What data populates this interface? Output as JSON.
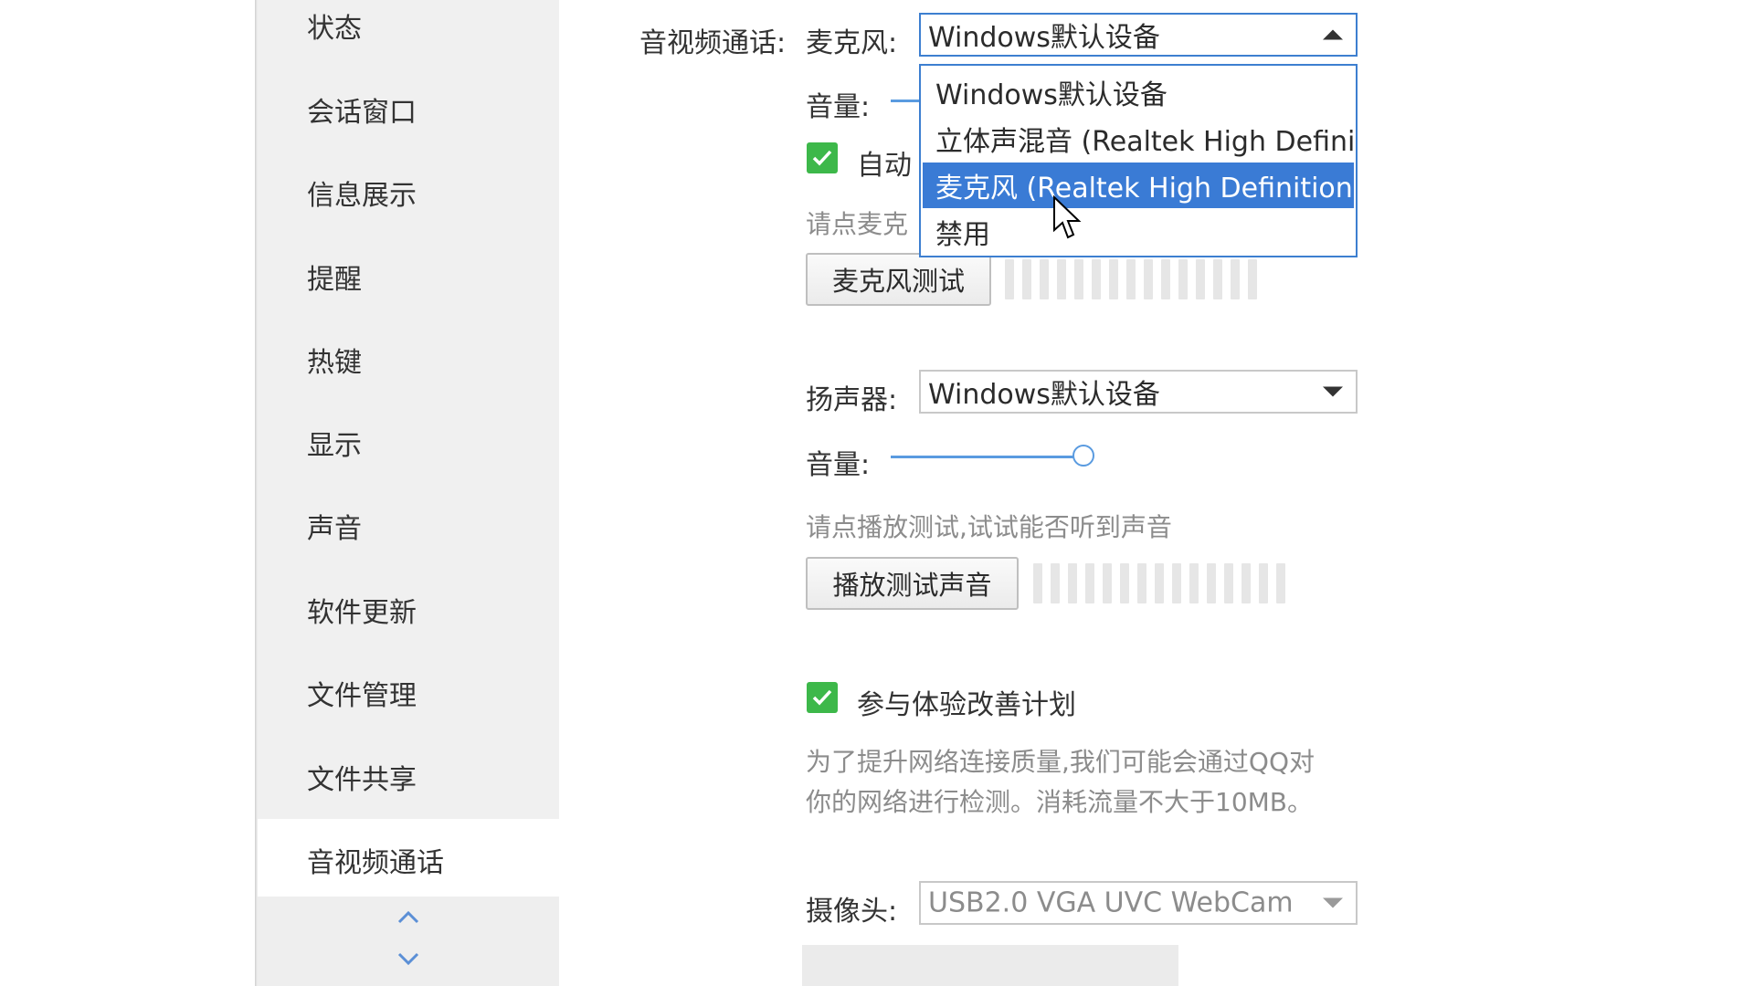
{
  "sidebar": {
    "items": [
      {
        "label": "状态"
      },
      {
        "label": "会话窗口"
      },
      {
        "label": "信息展示"
      },
      {
        "label": "提醒"
      },
      {
        "label": "热键"
      },
      {
        "label": "显示"
      },
      {
        "label": "声音"
      },
      {
        "label": "软件更新"
      },
      {
        "label": "文件管理"
      },
      {
        "label": "文件共享"
      },
      {
        "label": "音视频通话"
      }
    ],
    "active_index": 10,
    "scroll_up_icon": "chevron-up-icon",
    "scroll_down_icon": "chevron-down-icon"
  },
  "section": {
    "title": "音视频通话:"
  },
  "microphone": {
    "label": "麦克风:",
    "selected": "Windows默认设备",
    "volume_label": "音量:",
    "auto_adjust_label_partial": "自动",
    "hint_partial": "请点麦克",
    "test_button": "麦克风测试",
    "dropdown_open": true,
    "options": [
      "Windows默认设备",
      "立体声混音 (Realtek High Definit",
      "麦克风 (Realtek High Definition",
      "禁用"
    ],
    "highlighted_option_index": 2
  },
  "speaker": {
    "label": "扬声器:",
    "selected": "Windows默认设备",
    "volume_label": "音量:",
    "volume_level": 0.45,
    "hint": "请点播放测试,试试能否听到声音",
    "test_button": "播放测试声音"
  },
  "improvement": {
    "checked": true,
    "label": "参与体验改善计划",
    "desc_line1": "为了提升网络连接质量,我们可能会通过QQ对",
    "desc_line2": "你的网络进行检测。消耗流量不大于10MB。"
  },
  "camera": {
    "label": "摄像头:",
    "selected": "USB2.0 VGA UVC WebCam"
  },
  "colors": {
    "accent": "#3a7bd5",
    "checkbox_green": "#3db84a",
    "sidebar_bg": "#f0f0f0"
  }
}
